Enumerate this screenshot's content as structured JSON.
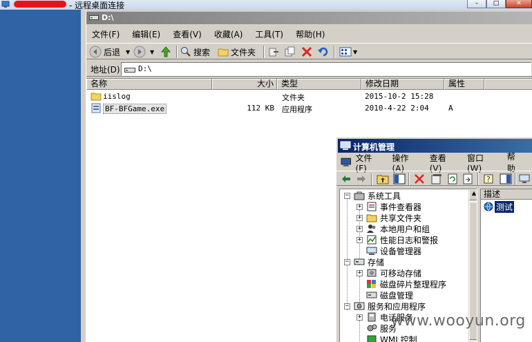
{
  "rdp": {
    "title": "- 远程桌面连接"
  },
  "explorer": {
    "title": "D:\\",
    "menu": [
      "文件(F)",
      "编辑(E)",
      "查看(V)",
      "收藏(A)",
      "工具(T)",
      "帮助(H)"
    ],
    "toolbar": {
      "back_label": "后退",
      "search_label": "搜索",
      "folders_label": "文件夹"
    },
    "address": {
      "label": "地址(D)",
      "value": "D:\\"
    },
    "columns": [
      "名称",
      "大小",
      "类型",
      "修改日期",
      "属性"
    ],
    "files": [
      {
        "name": "iislog",
        "size": "",
        "type": "文件夹",
        "modified": "2015-10-2 15:28",
        "attr": ""
      },
      {
        "name": "BF-BFGame.exe",
        "size": "112 KB",
        "type": "应用程序",
        "modified": "2010-4-22 2:04",
        "attr": "A"
      }
    ]
  },
  "computer_management": {
    "title": "计算机管理",
    "menu": [
      "文件(F)",
      "操作(A)",
      "查看(V)",
      "窗口(W)",
      "帮助"
    ],
    "tree": [
      {
        "label": "系统工具",
        "level": 0,
        "toggle": "−"
      },
      {
        "label": "事件查看器",
        "level": 1,
        "toggle": "+"
      },
      {
        "label": "共享文件夹",
        "level": 1,
        "toggle": "+"
      },
      {
        "label": "本地用户和组",
        "level": 1,
        "toggle": "+"
      },
      {
        "label": "性能日志和警报",
        "level": 1,
        "toggle": "+"
      },
      {
        "label": "设备管理器",
        "level": 1,
        "toggle": ""
      },
      {
        "label": "存储",
        "level": 0,
        "toggle": "−"
      },
      {
        "label": "可移动存储",
        "level": 1,
        "toggle": "+"
      },
      {
        "label": "磁盘碎片整理程序",
        "level": 1,
        "toggle": ""
      },
      {
        "label": "磁盘管理",
        "level": 1,
        "toggle": ""
      },
      {
        "label": "服务和应用程序",
        "level": 0,
        "toggle": "−"
      },
      {
        "label": "电话服务",
        "level": 1,
        "toggle": "+"
      },
      {
        "label": "服务",
        "level": 1,
        "toggle": ""
      },
      {
        "label": "WMI 控制",
        "level": 1,
        "toggle": ""
      }
    ],
    "right_pane": {
      "header": "描述",
      "item": "测试"
    }
  },
  "watermark": "www.wooyun.org"
}
